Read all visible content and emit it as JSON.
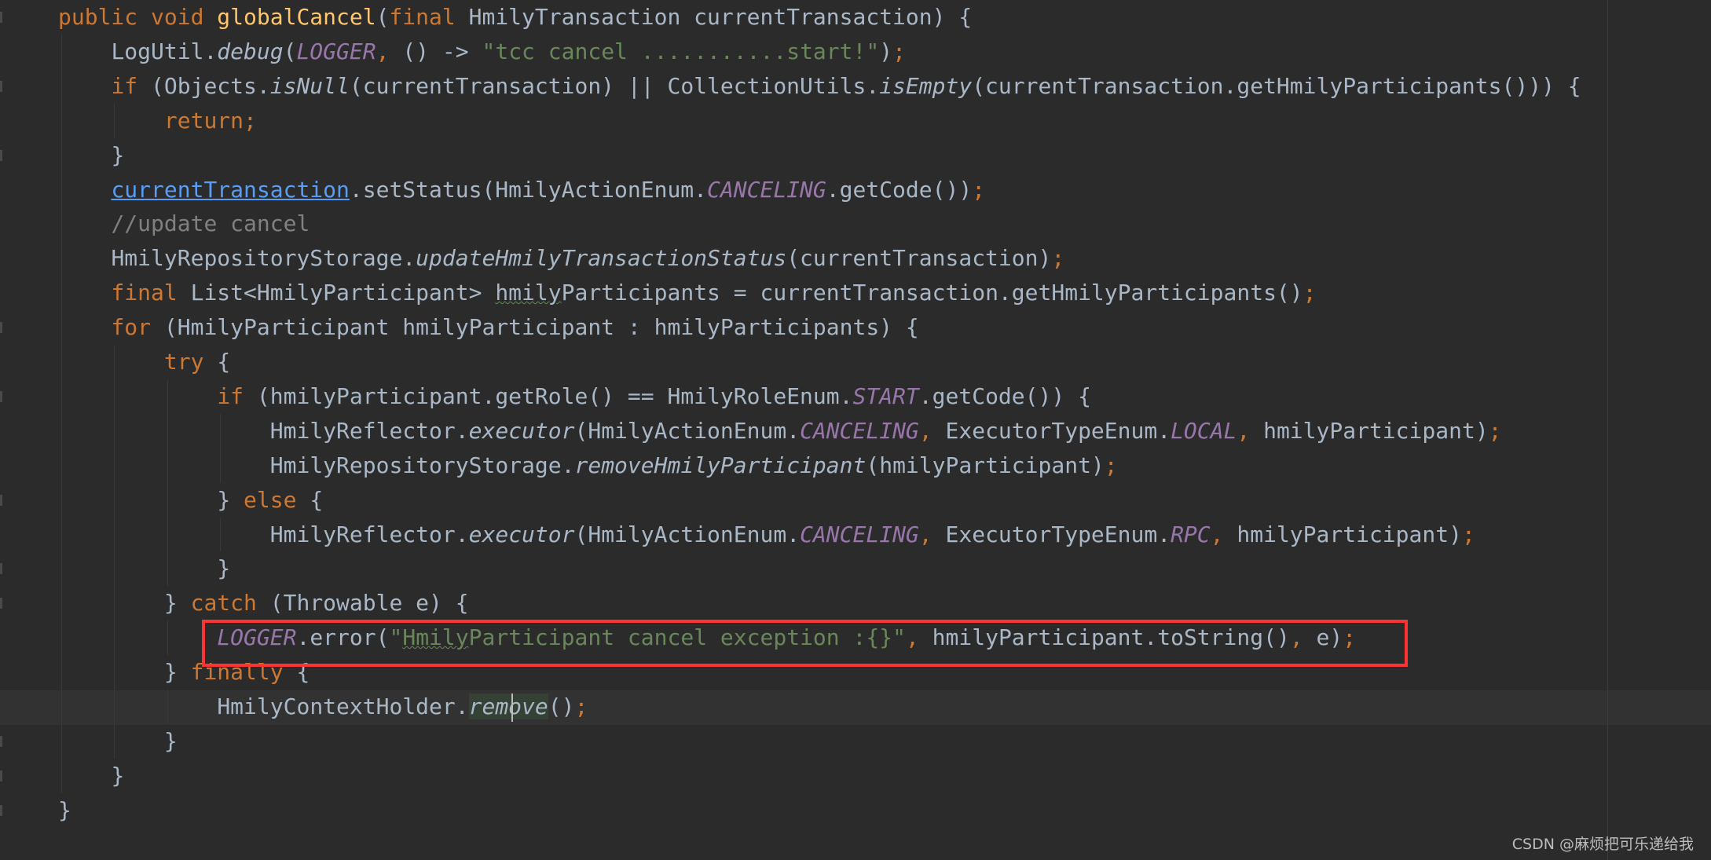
{
  "editor": {
    "colors": {
      "background": "#2b2b2b",
      "keyword": "#cc7832",
      "text": "#a9b7c6",
      "function_declaration": "#ffc66d",
      "string": "#6a8759",
      "constant": "#9876aa",
      "comment": "#808080",
      "link": "#589df6",
      "highlight_box": "#ff3333"
    },
    "current_line": 20,
    "highlighted_line": 18,
    "lines": [
      {
        "indent": 0,
        "tokens": [
          [
            "k",
            "public void "
          ],
          [
            "f",
            "globalCancel"
          ],
          [
            "t",
            "("
          ],
          [
            "k",
            "final "
          ],
          [
            "t",
            "HmilyTransaction currentTransaction) {"
          ]
        ]
      },
      {
        "indent": 1,
        "tokens": [
          [
            "t",
            "LogUtil."
          ],
          [
            "i",
            "debug"
          ],
          [
            "t",
            "("
          ],
          [
            "c",
            "LOGGER"
          ],
          [
            "p",
            ", "
          ],
          [
            "t",
            "() -> "
          ],
          [
            "s",
            "\"tcc cancel ...........start!\""
          ],
          [
            "t",
            ")"
          ],
          [
            "p",
            ";"
          ]
        ]
      },
      {
        "indent": 1,
        "tokens": [
          [
            "k",
            "if "
          ],
          [
            "t",
            "(Objects."
          ],
          [
            "i",
            "isNull"
          ],
          [
            "t",
            "(currentTransaction) || CollectionUtils."
          ],
          [
            "i",
            "isEmpty"
          ],
          [
            "t",
            "(currentTransaction.getHmilyParticipants())) {"
          ]
        ]
      },
      {
        "indent": 2,
        "tokens": [
          [
            "k",
            "return;"
          ]
        ]
      },
      {
        "indent": 1,
        "tokens": [
          [
            "t",
            "}"
          ]
        ]
      },
      {
        "indent": 1,
        "tokens": [
          [
            "u",
            "currentTransaction"
          ],
          [
            "t",
            ".setStatus(HmilyActionEnum."
          ],
          [
            "c",
            "CANCELING"
          ],
          [
            "t",
            ".getCode())"
          ],
          [
            "p",
            ";"
          ]
        ]
      },
      {
        "indent": 1,
        "tokens": [
          [
            "m",
            "//update cancel"
          ]
        ]
      },
      {
        "indent": 1,
        "tokens": [
          [
            "t",
            "HmilyRepositoryStorage."
          ],
          [
            "i",
            "updateHmilyTransactionStatus"
          ],
          [
            "t",
            "(currentTransaction)"
          ],
          [
            "p",
            ";"
          ]
        ]
      },
      {
        "indent": 1,
        "tokens": [
          [
            "k",
            "final "
          ],
          [
            "t",
            "List<HmilyParticipant> "
          ],
          [
            "tw",
            "hmily"
          ],
          [
            "t",
            "Participants = currentTransaction.getHmilyParticipants()"
          ],
          [
            "p",
            ";"
          ]
        ]
      },
      {
        "indent": 1,
        "tokens": [
          [
            "k",
            "for "
          ],
          [
            "t",
            "(HmilyParticipant hmilyParticipant : hmilyParticipants) {"
          ]
        ]
      },
      {
        "indent": 2,
        "tokens": [
          [
            "k",
            "try "
          ],
          [
            "t",
            "{"
          ]
        ]
      },
      {
        "indent": 3,
        "tokens": [
          [
            "k",
            "if "
          ],
          [
            "t",
            "(hmilyParticipant.getRole() == HmilyRoleEnum."
          ],
          [
            "c",
            "START"
          ],
          [
            "t",
            ".getCode()) {"
          ]
        ]
      },
      {
        "indent": 4,
        "tokens": [
          [
            "t",
            "HmilyReflector."
          ],
          [
            "i",
            "executor"
          ],
          [
            "t",
            "(HmilyActionEnum."
          ],
          [
            "c",
            "CANCELING"
          ],
          [
            "p",
            ", "
          ],
          [
            "t",
            "ExecutorTypeEnum."
          ],
          [
            "c",
            "LOCAL"
          ],
          [
            "p",
            ", "
          ],
          [
            "t",
            "hmilyParticipant)"
          ],
          [
            "p",
            ";"
          ]
        ]
      },
      {
        "indent": 4,
        "tokens": [
          [
            "t",
            "HmilyRepositoryStorage."
          ],
          [
            "i",
            "removeHmilyParticipant"
          ],
          [
            "t",
            "(hmilyParticipant)"
          ],
          [
            "p",
            ";"
          ]
        ]
      },
      {
        "indent": 3,
        "tokens": [
          [
            "t",
            "} "
          ],
          [
            "k",
            "else "
          ],
          [
            "t",
            "{"
          ]
        ]
      },
      {
        "indent": 4,
        "tokens": [
          [
            "t",
            "HmilyReflector."
          ],
          [
            "i",
            "executor"
          ],
          [
            "t",
            "(HmilyActionEnum."
          ],
          [
            "c",
            "CANCELING"
          ],
          [
            "p",
            ", "
          ],
          [
            "t",
            "ExecutorTypeEnum."
          ],
          [
            "c",
            "RPC"
          ],
          [
            "p",
            ", "
          ],
          [
            "t",
            "hmilyParticipant)"
          ],
          [
            "p",
            ";"
          ]
        ]
      },
      {
        "indent": 3,
        "tokens": [
          [
            "t",
            "}"
          ]
        ]
      },
      {
        "indent": 2,
        "tokens": [
          [
            "t",
            "} "
          ],
          [
            "k",
            "catch "
          ],
          [
            "t",
            "(Throwable e) {"
          ]
        ]
      },
      {
        "indent": 3,
        "tokens": [
          [
            "c",
            "LOGGER"
          ],
          [
            "t",
            ".error("
          ],
          [
            "s",
            "\""
          ],
          [
            "sw",
            "Hmily"
          ],
          [
            "s",
            "Participant cancel exception :{}\""
          ],
          [
            "p",
            ", "
          ],
          [
            "t",
            "hmilyParticipant.toString()"
          ],
          [
            "p",
            ", "
          ],
          [
            "t",
            "e)"
          ],
          [
            "p",
            ";"
          ]
        ]
      },
      {
        "indent": 2,
        "tokens": [
          [
            "t",
            "} "
          ],
          [
            "k",
            "finally "
          ],
          [
            "t",
            "{"
          ]
        ]
      },
      {
        "indent": 3,
        "tokens": [
          [
            "t",
            "HmilyContextHolder."
          ],
          [
            "ih",
            "remove"
          ],
          [
            "t",
            "()"
          ],
          [
            "p",
            ";"
          ]
        ]
      },
      {
        "indent": 2,
        "tokens": [
          [
            "t",
            "}"
          ]
        ]
      },
      {
        "indent": 1,
        "tokens": [
          [
            "t",
            "}"
          ]
        ]
      },
      {
        "indent": 0,
        "tokens": [
          [
            "t",
            "}"
          ]
        ]
      }
    ]
  },
  "watermark": "CSDN @麻烦把可乐递给我"
}
